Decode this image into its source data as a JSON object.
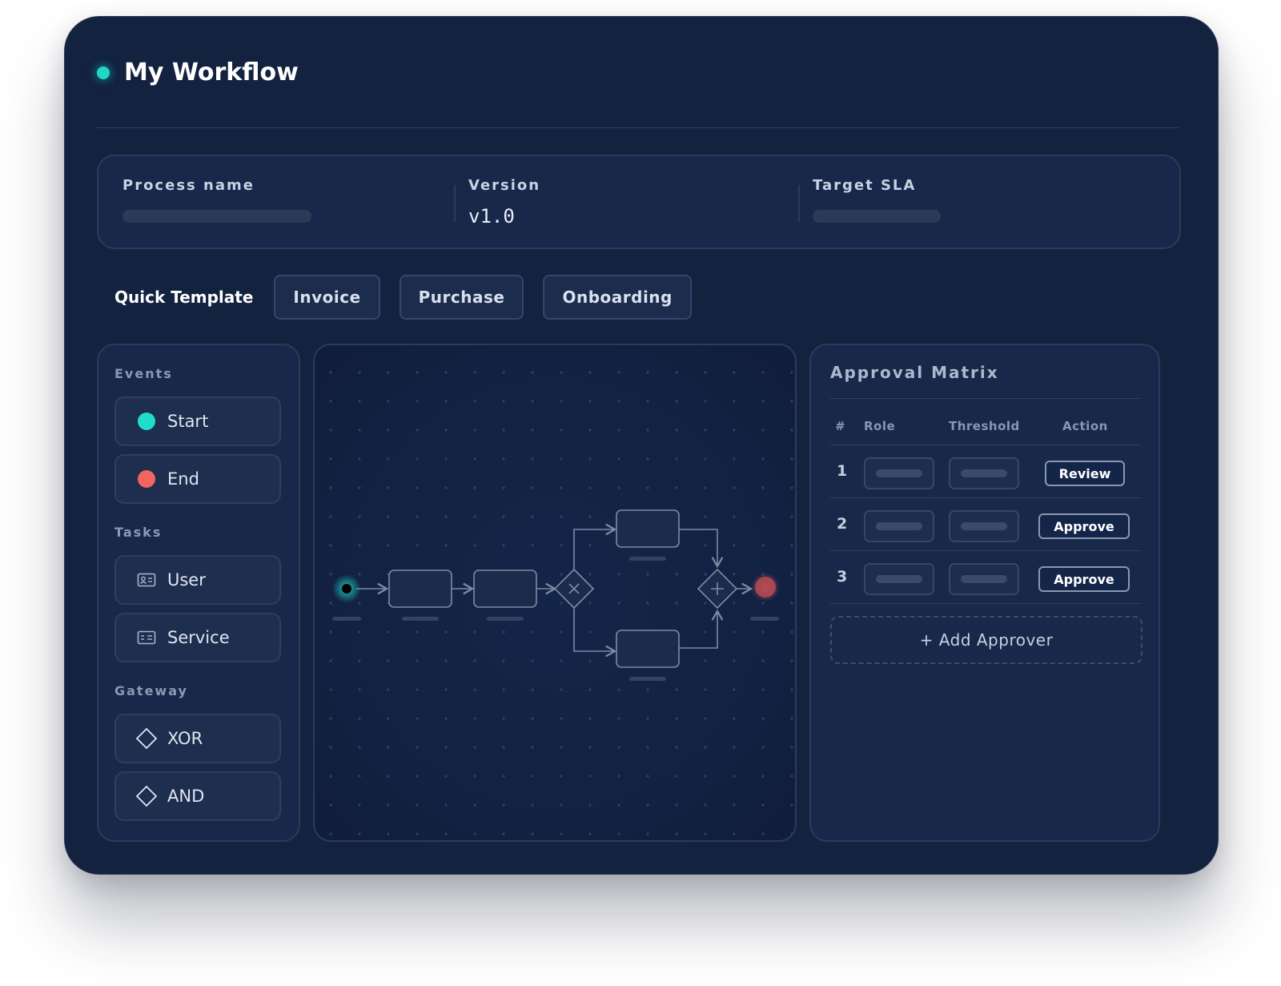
{
  "app": {
    "title": "My Workflow"
  },
  "info": {
    "process_name_label": "Process name",
    "version_label": "Version",
    "version_value": "v1.0",
    "sla_label": "Target SLA"
  },
  "templates": {
    "label": "Quick Template",
    "buttons": [
      "Invoice",
      "Purchase",
      "Onboarding"
    ]
  },
  "palette": {
    "events_label": "Events",
    "events": [
      {
        "label": "Start",
        "icon": "start-event-icon"
      },
      {
        "label": "End",
        "icon": "end-event-icon"
      }
    ],
    "tasks_label": "Tasks",
    "tasks": [
      {
        "label": "User",
        "icon": "user-task-icon"
      },
      {
        "label": "Service",
        "icon": "service-task-icon"
      }
    ],
    "gateway_label": "Gateway",
    "gateways": [
      {
        "label": "XOR",
        "icon": "diamond-icon"
      },
      {
        "label": "AND",
        "icon": "diamond-icon"
      }
    ]
  },
  "matrix": {
    "title": "Approval Matrix",
    "headers": {
      "num": "#",
      "role": "Role",
      "threshold": "Threshold",
      "action": "Action"
    },
    "rows": [
      {
        "num": "1",
        "action": "Review"
      },
      {
        "num": "2",
        "action": "Approve"
      },
      {
        "num": "3",
        "action": "Approve"
      }
    ],
    "add_label": "+ Add Approver"
  },
  "colors": {
    "window_bg": "#12223f",
    "accent_teal": "#1fd6c7",
    "accent_red": "#f1645f",
    "panel_border": "#2b3c5a"
  }
}
